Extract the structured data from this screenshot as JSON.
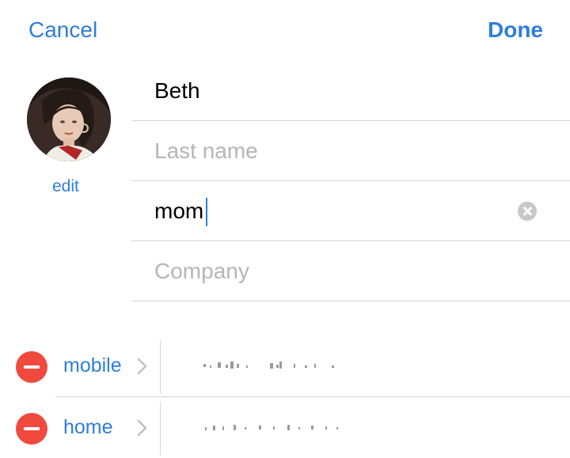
{
  "nav": {
    "cancel_label": "Cancel",
    "done_label": "Done"
  },
  "photo": {
    "edit_label": "edit"
  },
  "fields": {
    "first_name": {
      "value": "Beth",
      "placeholder": ""
    },
    "last_name": {
      "value": "",
      "placeholder": "Last name"
    },
    "nickname": {
      "value": "mom",
      "placeholder": ""
    },
    "company": {
      "value": "",
      "placeholder": "Company"
    }
  },
  "phones": [
    {
      "label": "mobile",
      "number": ""
    },
    {
      "label": "home",
      "number": ""
    }
  ],
  "colors": {
    "accent": "#2f7ddb",
    "delete": "#f04a3e",
    "placeholder": "#b5b5ba",
    "separator": "#d6d6d8"
  },
  "icons": {
    "clear": "clear-text-icon",
    "chevron": "chevron-right-icon",
    "remove": "minus-circle-icon"
  }
}
